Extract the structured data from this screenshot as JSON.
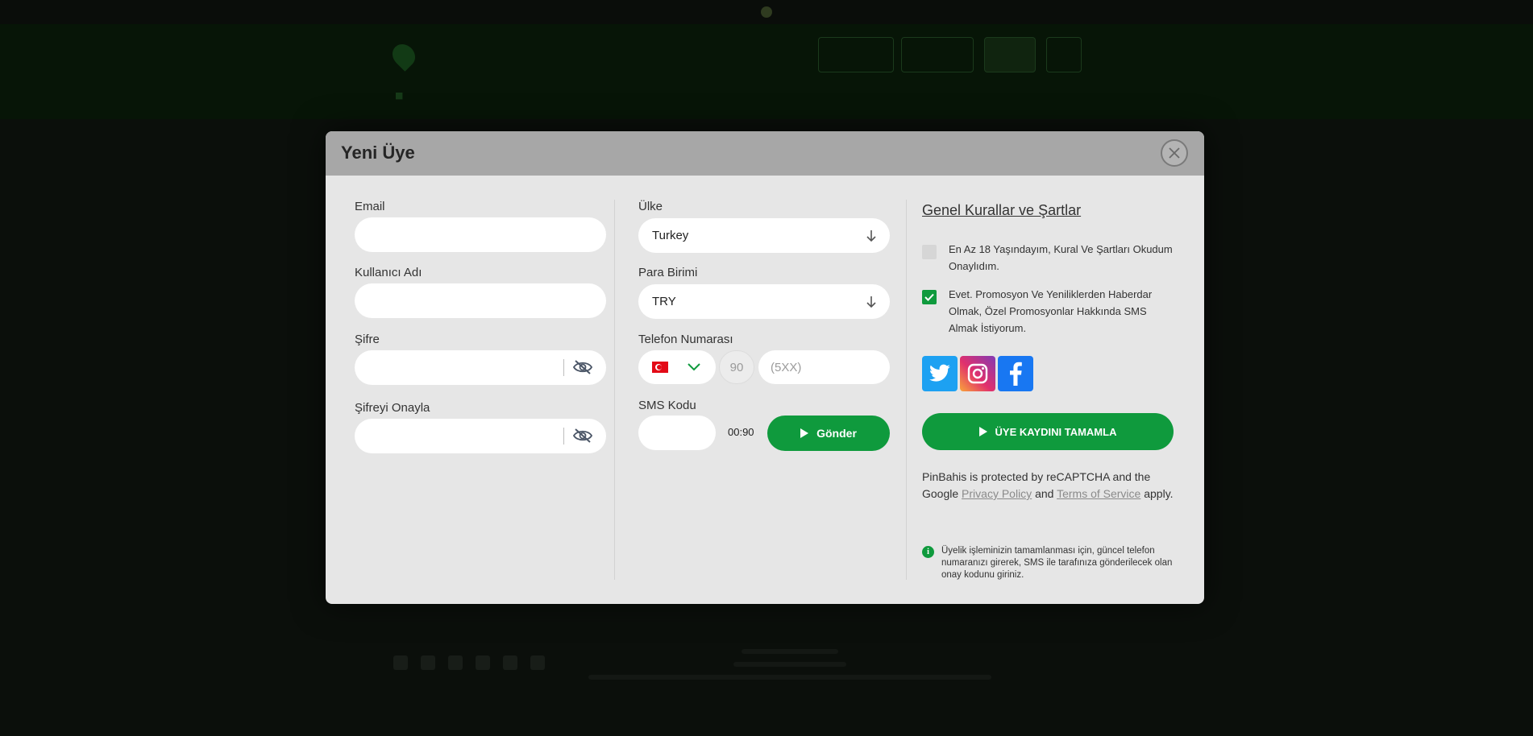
{
  "modal": {
    "title": "Yeni Üye"
  },
  "form": {
    "email": {
      "label": "Email",
      "value": ""
    },
    "username": {
      "label": "Kullanıcı Adı",
      "value": ""
    },
    "password": {
      "label": "Şifre",
      "value": ""
    },
    "password_confirm": {
      "label": "Şifreyi Onayla",
      "value": ""
    },
    "country": {
      "label": "Ülke",
      "value": "Turkey"
    },
    "currency": {
      "label": "Para Birimi",
      "value": "TRY"
    },
    "phone": {
      "label": "Telefon Numarası",
      "country_code": "90",
      "placeholder": "(5XX)",
      "flag": "turkey-flag"
    },
    "sms": {
      "label": "SMS Kodu",
      "timer": "00:90",
      "send_label": "Gönder"
    }
  },
  "terms": {
    "link_label": "Genel Kurallar ve Şartlar",
    "age_check": {
      "text": "En Az 18 Yaşındayım, Kural Ve Şartları Okudum Onaylıdım.",
      "checked": false
    },
    "promo_check": {
      "text": "Evet. Promosyon Ve Yeniliklerden Haberdar Olmak, Özel Promosyonlar Hakkında SMS Almak İstiyorum.",
      "checked": true
    },
    "social_icons": [
      "twitter-icon",
      "instagram-icon",
      "facebook-icon"
    ],
    "complete_label": "ÜYE KAYDINI TAMAMLA",
    "recaptcha": {
      "pre": "PinBahis is protected by reCAPTCHA and the Google",
      "privacy": "Privacy Policy",
      "and": "and",
      "tos": "Terms of Service",
      "post": "apply."
    },
    "info": "Üyelik işleminizin tamamlanması için, güncel telefon numaranızı girerek, SMS ile tarafınıza gönderilecek olan onay kodunu giriniz."
  },
  "colors": {
    "accent": "#0f9a3d",
    "modal_bg": "#e6e6e6",
    "modal_header": "#a7a7a7"
  }
}
